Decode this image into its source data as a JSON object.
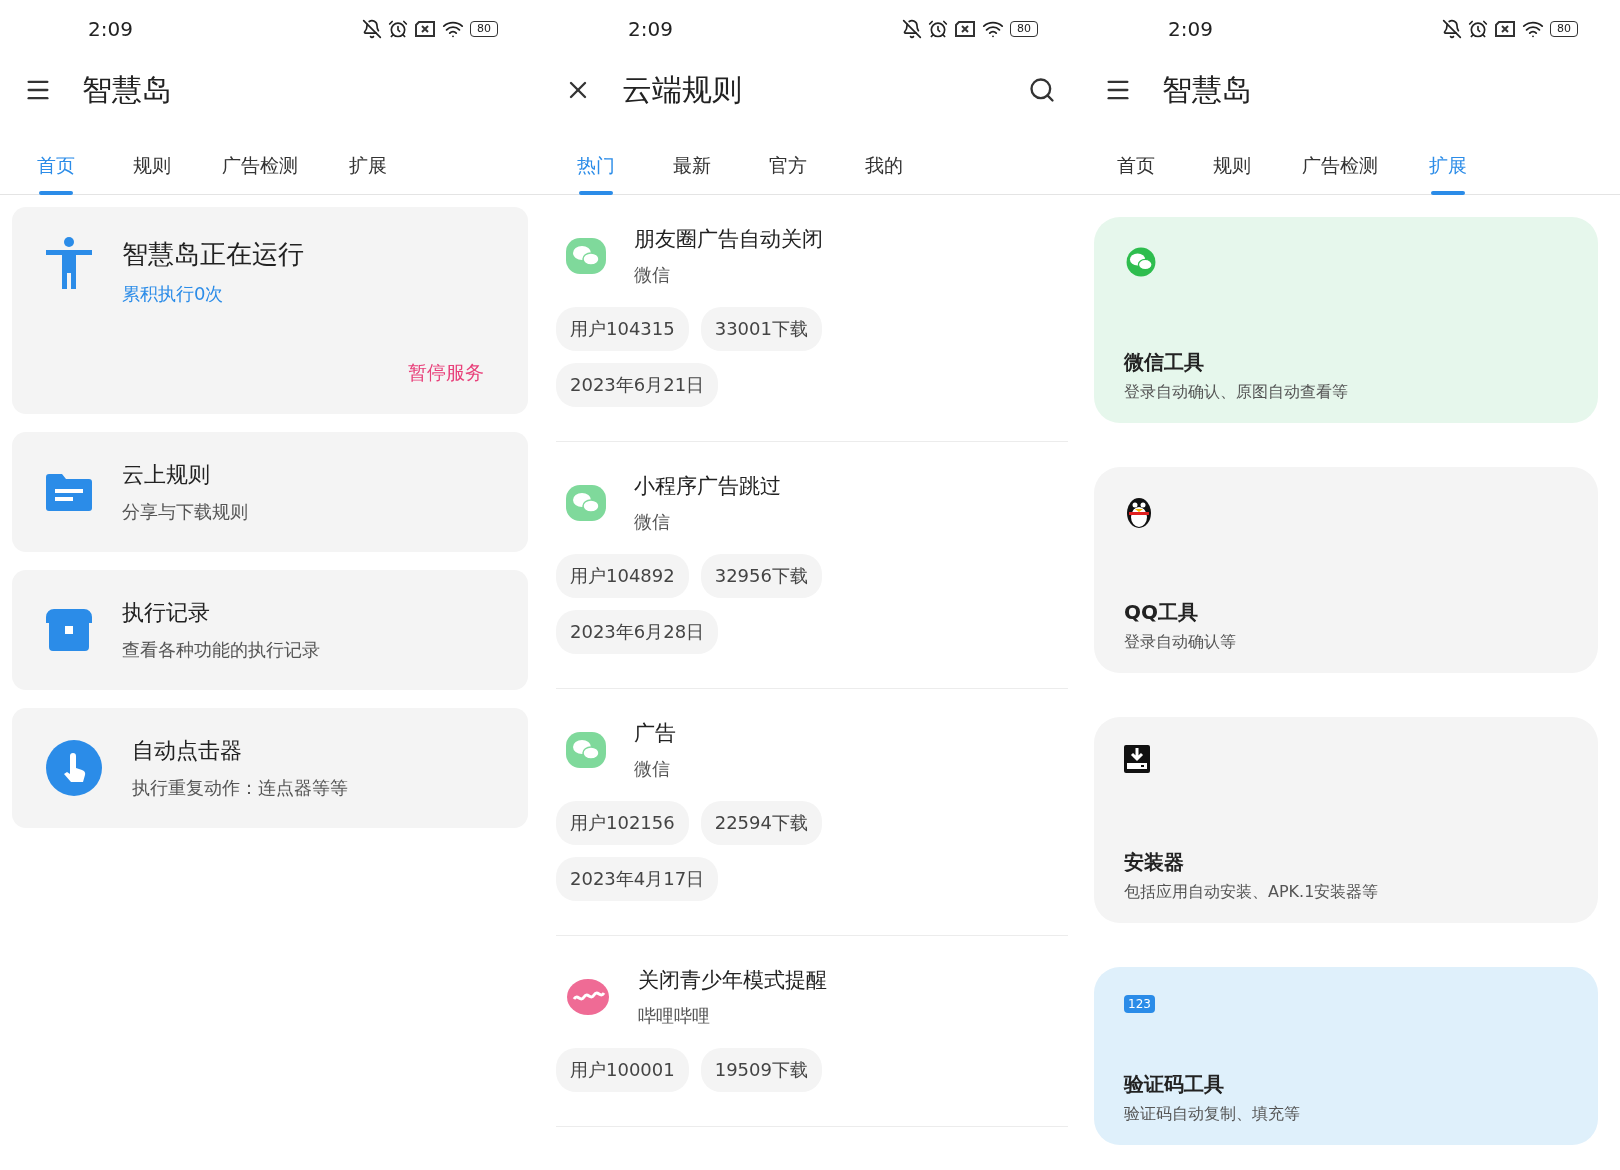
{
  "panels": [
    {
      "kind": "home",
      "status_bar": {
        "time": "2:09",
        "battery": "80"
      },
      "toolbar": {
        "kind": "menu",
        "title": "智慧岛",
        "search": false
      },
      "tabs": [
        {
          "label": "首页",
          "selected": true
        },
        {
          "label": "规则",
          "selected": false
        },
        {
          "label": "广告检测",
          "selected": false
        },
        {
          "label": "扩展",
          "selected": false
        }
      ],
      "service_card": {
        "title": "智慧岛正在运行",
        "subtitle": "累积执行0次",
        "action": "暂停服务"
      },
      "feature_cards": [
        {
          "title": "云上规则",
          "subtitle": "分享与下载规则"
        },
        {
          "title": "执行记录",
          "subtitle": "查看各种功能的执行记录"
        },
        {
          "title": "自动点击器",
          "subtitle": "执行重复动作：连点器等等"
        }
      ]
    },
    {
      "kind": "rules",
      "status_bar": {
        "time": "2:09",
        "battery": "80"
      },
      "toolbar": {
        "kind": "close",
        "title": "云端规则",
        "search": true
      },
      "tabs": [
        {
          "label": "热门",
          "selected": true
        },
        {
          "label": "最新",
          "selected": false
        },
        {
          "label": "官方",
          "selected": false
        },
        {
          "label": "我的",
          "selected": false
        }
      ],
      "rules": [
        {
          "title": "朋友圈广告自动关闭",
          "app": "微信",
          "user": "用户104315",
          "downloads": "33001下载",
          "date": "2023年6月21日"
        },
        {
          "title": "小程序广告跳过",
          "app": "微信",
          "user": "用户104892",
          "downloads": "32956下载",
          "date": "2023年6月28日"
        },
        {
          "title": "广告",
          "app": "微信",
          "user": "用户102156",
          "downloads": "22594下载",
          "date": "2023年4月17日"
        },
        {
          "title": "关闭青少年模式提醒",
          "app": "哔哩哔哩",
          "user": "用户100001",
          "downloads": "19509下载"
        }
      ]
    },
    {
      "kind": "extensions",
      "status_bar": {
        "time": "2:09",
        "battery": "80"
      },
      "toolbar": {
        "kind": "menu",
        "title": "智慧岛",
        "search": false
      },
      "tabs": [
        {
          "label": "首页",
          "selected": false
        },
        {
          "label": "规则",
          "selected": false
        },
        {
          "label": "广告检测",
          "selected": false
        },
        {
          "label": "扩展",
          "selected": true
        }
      ],
      "tools": [
        {
          "title": "微信工具",
          "subtitle": "登录自动确认、原图自动查看等",
          "color": "#e6f7ec"
        },
        {
          "title": "QQ工具",
          "subtitle": "登录自动确认等",
          "color": "#f4f4f4"
        },
        {
          "title": "安装器",
          "subtitle": "包括应用自动安装、APK.1安装器等",
          "color": "#f4f4f4"
        },
        {
          "title": "验证码工具",
          "subtitle": "验证码自动复制、填充等",
          "color": "#dff0fb",
          "badge": "123"
        }
      ]
    }
  ]
}
